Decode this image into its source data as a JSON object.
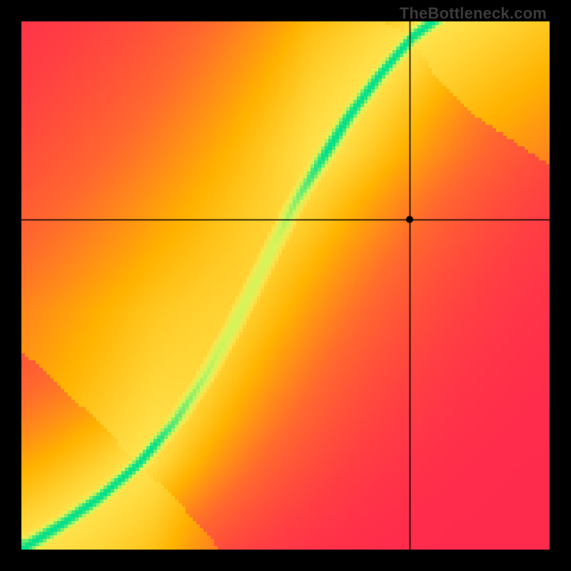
{
  "watermark": "TheBottleneck.com",
  "chart_data": {
    "type": "heatmap",
    "title": "",
    "xlabel": "",
    "ylabel": "",
    "xlim": [
      0,
      1
    ],
    "ylim": [
      0,
      1
    ],
    "grid_resolution": 148,
    "colorscale": [
      {
        "t": 0.0,
        "hex": "#ff2b4d"
      },
      {
        "t": 0.3,
        "hex": "#ff6a2e"
      },
      {
        "t": 0.55,
        "hex": "#ffb300"
      },
      {
        "t": 0.78,
        "hex": "#ffe34d"
      },
      {
        "t": 0.9,
        "hex": "#d6f55a"
      },
      {
        "t": 1.0,
        "hex": "#00e08a"
      }
    ],
    "ridge": {
      "description": "approximate (x, y) points of the green optimal-balance curve, in normalized [0,1] plot coordinates (origin at lower-left)",
      "points": [
        [
          0.0,
          0.0
        ],
        [
          0.08,
          0.05
        ],
        [
          0.15,
          0.1
        ],
        [
          0.22,
          0.16
        ],
        [
          0.29,
          0.24
        ],
        [
          0.35,
          0.33
        ],
        [
          0.4,
          0.42
        ],
        [
          0.44,
          0.5
        ],
        [
          0.48,
          0.58
        ],
        [
          0.52,
          0.66
        ],
        [
          0.57,
          0.74
        ],
        [
          0.62,
          0.82
        ],
        [
          0.68,
          0.9
        ],
        [
          0.74,
          0.97
        ],
        [
          0.78,
          1.0
        ]
      ],
      "half_width_normalized": 0.045
    },
    "crosshair": {
      "x": 0.735,
      "y": 0.625
    },
    "marker": {
      "x": 0.735,
      "y": 0.625,
      "radius_px": 5
    },
    "colors": {
      "crosshair": "#000000",
      "marker_fill": "#000000"
    }
  }
}
